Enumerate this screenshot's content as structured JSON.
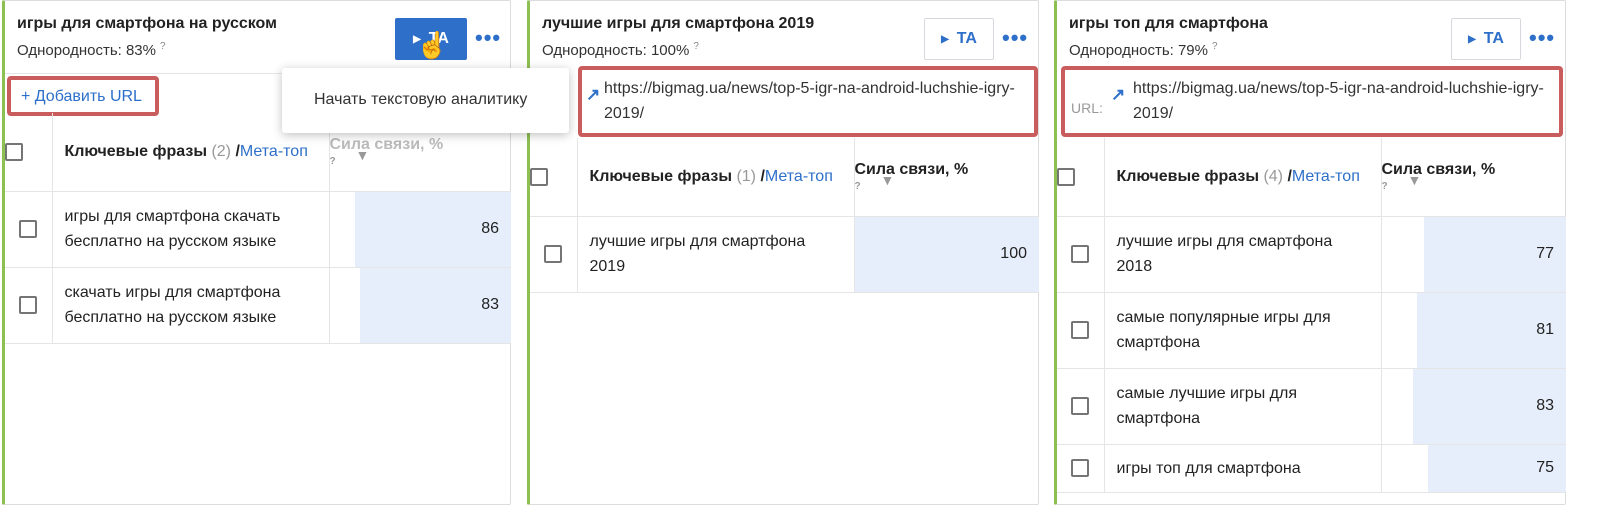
{
  "panels": [
    {
      "title": "игры для смартфона на русском",
      "homogeneity": "Однородность: 83%",
      "help": "?",
      "ta_label": "TA",
      "add_url": "+ Добавить URL",
      "header": {
        "phrases": "Ключевые фразы",
        "count": "(2)",
        "sep": " /",
        "meta": "Мета-топ",
        "strength": "Сила связи, %",
        "help": "?"
      },
      "rows": [
        {
          "phrase": "игры для смартфона скачать бесплатно на русском языке",
          "value": "86",
          "bar": 0.86
        },
        {
          "phrase": "скачать игры для смартфона бесплатно на русском языке",
          "value": "83",
          "bar": 0.83
        }
      ]
    },
    {
      "title": "лучшие игры для смартфона 2019",
      "homogeneity": "Однородность: 100%",
      "help": "?",
      "ta_label": "TA",
      "url": "https://bigmag.ua/news/top-5-igr-na-android-luchshie-igry-2019/",
      "header": {
        "phrases": "Ключевые фразы",
        "count": "(1)",
        "sep": " /",
        "meta": "Мета-топ",
        "strength": "Сила связи, %",
        "help": "?"
      },
      "rows": [
        {
          "phrase": "лучшие игры для смартфона 2019",
          "value": "100",
          "bar": 1.0
        }
      ]
    },
    {
      "title": "игры топ для смартфона",
      "homogeneity": "Однородность: 79%",
      "help": "?",
      "ta_label": "TA",
      "url_label": "URL:",
      "url": "https://bigmag.ua/news/top-5-igr-na-android-luchshie-igry-2019/",
      "header": {
        "phrases": "Ключевые фразы",
        "count": "(4)",
        "sep": " /",
        "meta": "Мета-топ",
        "strength": "Сила связи, %",
        "help": "?"
      },
      "rows": [
        {
          "phrase": "лучшие игры для смартфона 2018",
          "value": "77",
          "bar": 0.77
        },
        {
          "phrase": "самые популярные игры для смартфона",
          "value": "81",
          "bar": 0.81
        },
        {
          "phrase": "самые лучшие игры для смартфона",
          "value": "83",
          "bar": 0.83
        },
        {
          "phrase": "игры топ для смартфона",
          "value": "75",
          "bar": 0.75
        }
      ]
    }
  ],
  "tooltip": "Начать текстовую аналитику",
  "icons": {
    "play": "play-icon",
    "more": "more-dots-icon",
    "external": "external-link-icon",
    "caret": "sort-caret-icon",
    "cursor": "hand-cursor-icon"
  },
  "colors": {
    "accent": "#2d6fc9",
    "panel_border": "#8cc152",
    "highlight": "#c95d5d",
    "bar": "#e7eefb"
  }
}
